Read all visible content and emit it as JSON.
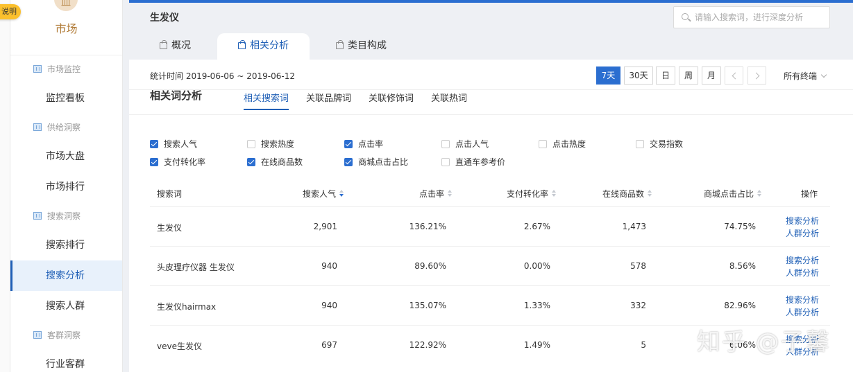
{
  "explain_badge": "说明",
  "sidebar": {
    "logo_glyph": "皿",
    "logo_label": "市场",
    "groups": [
      {
        "label": "市场监控",
        "items": [
          "监控看板"
        ]
      },
      {
        "label": "供给洞察",
        "items": [
          "市场大盘",
          "市场排行"
        ]
      },
      {
        "label": "搜索洞察",
        "items": [
          "搜索排行",
          "搜索分析",
          "搜索人群"
        ]
      },
      {
        "label": "客群洞察",
        "items": [
          "行业客群"
        ]
      }
    ],
    "active_item": "搜索分析"
  },
  "header": {
    "title": "生发仪",
    "search_placeholder": "请输入搜索词，进行深度分析",
    "tabs": [
      "概况",
      "相关分析",
      "类目构成"
    ],
    "active_tab": "相关分析"
  },
  "stat": {
    "time_label": "统计时间 2019-06-06 ~ 2019-06-12",
    "ranges": [
      "7天",
      "30天",
      "日",
      "周",
      "月"
    ],
    "active_range": "7天",
    "terminal": "所有终端"
  },
  "section": {
    "title": "相关词分析",
    "sub_tabs": [
      "相关搜索词",
      "关联品牌词",
      "关联修饰词",
      "关联热词"
    ],
    "active_sub_tab": "相关搜索词"
  },
  "metrics": [
    {
      "label": "搜索人气",
      "checked": true
    },
    {
      "label": "搜索热度",
      "checked": false
    },
    {
      "label": "点击率",
      "checked": true
    },
    {
      "label": "点击人气",
      "checked": false
    },
    {
      "label": "点击热度",
      "checked": false
    },
    {
      "label": "交易指数",
      "checked": false
    },
    {
      "label": "支付转化率",
      "checked": true
    },
    {
      "label": "在线商品数",
      "checked": true
    },
    {
      "label": "商城点击占比",
      "checked": true
    },
    {
      "label": "直通车参考价",
      "checked": false
    }
  ],
  "table": {
    "columns": [
      "搜索词",
      "搜索人气",
      "点击率",
      "支付转化率",
      "在线商品数",
      "商城点击占比",
      "操作"
    ],
    "rows": [
      {
        "term": "生发仪",
        "popularity": "2,901",
        "ctr": "136.21%",
        "cvr": "2.67%",
        "items": "1,473",
        "mall_ratio": "74.75%"
      },
      {
        "term": "头皮理疗仪器 生发仪",
        "popularity": "940",
        "ctr": "89.60%",
        "cvr": "0.00%",
        "items": "578",
        "mall_ratio": "8.56%"
      },
      {
        "term": "生发仪hairmax",
        "popularity": "940",
        "ctr": "135.07%",
        "cvr": "1.33%",
        "items": "332",
        "mall_ratio": "82.96%"
      },
      {
        "term": "veve生发仪",
        "popularity": "697",
        "ctr": "122.92%",
        "cvr": "1.49%",
        "items": "5",
        "mall_ratio": "6.06%"
      }
    ],
    "actions": [
      "搜索分析",
      "人群分析"
    ]
  },
  "watermark": "知乎 @子馨"
}
